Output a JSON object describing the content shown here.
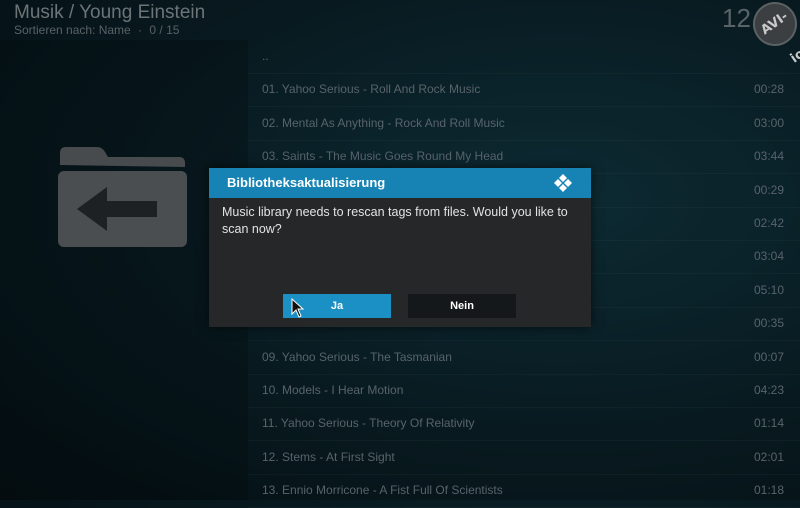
{
  "header": {
    "title": "Musik / Young Einstein",
    "sort_label": "Sortieren nach: Name",
    "separator": "·",
    "count": "0 / 15",
    "clock": "12",
    "logo_text": "AVI-io"
  },
  "left_panel": {
    "icon": "back-folder-icon"
  },
  "tracks": [
    {
      "title": "..",
      "duration": ""
    },
    {
      "title": "01. Yahoo Serious - Roll And Rock Music",
      "duration": "00:28"
    },
    {
      "title": "02. Mental As Anything - Rock And Roll Music",
      "duration": "03:00"
    },
    {
      "title": "03. Saints - The Music Goes Round My Head",
      "duration": "03:44"
    },
    {
      "title": "",
      "duration": "00:29"
    },
    {
      "title": "",
      "duration": "02:42"
    },
    {
      "title": "",
      "duration": "03:04"
    },
    {
      "title": "",
      "duration": "05:10"
    },
    {
      "title": "",
      "duration": "00:35"
    },
    {
      "title": "09. Yahoo Serious - The Tasmanian",
      "duration": "00:07"
    },
    {
      "title": "10. Models - I Hear Motion",
      "duration": "04:23"
    },
    {
      "title": "11. Yahoo Serious - Theory Of Relativity",
      "duration": "01:14"
    },
    {
      "title": "12. Stems - At First Sight",
      "duration": "02:01"
    },
    {
      "title": "13. Ennio Morricone - A Fist Full Of Scientists",
      "duration": "01:18"
    }
  ],
  "dialog": {
    "title": "Bibliotheksaktualisierung",
    "message": "Music library needs to rescan tags from files. Would you like to scan now?",
    "yes_label": "Ja",
    "no_label": "Nein",
    "icon": "kodi-icon",
    "accent_color": "#1683b4",
    "focused_button": "yes"
  },
  "colors": {
    "background": "#081a20",
    "dialog_header": "#1683b4",
    "dialog_body": "#252729",
    "focused_button": "#1a90c4",
    "unfocused_button": "#15181a"
  }
}
